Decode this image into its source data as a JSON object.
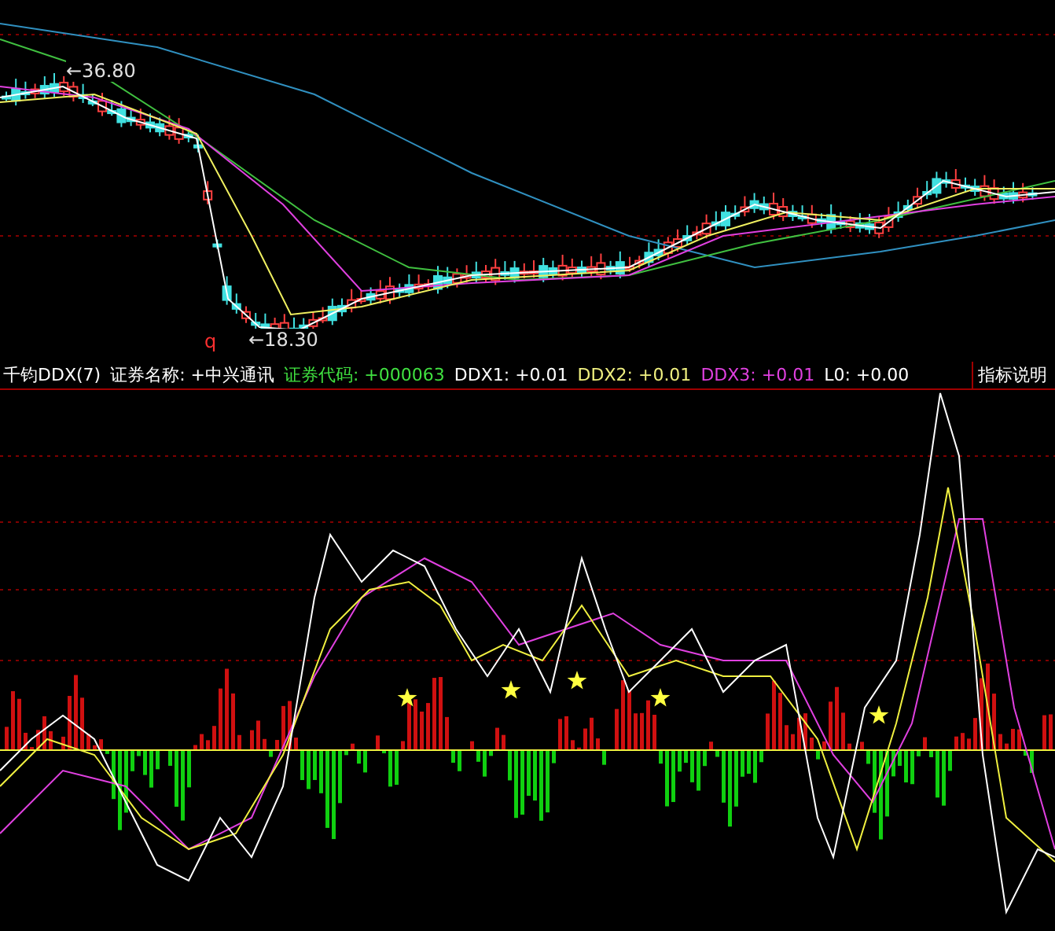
{
  "price_chart": {
    "high_label": "←36.80",
    "low_label": "←18.30",
    "marker": "q"
  },
  "indicator": {
    "legend": [
      {
        "text": "千钧DDX(7)",
        "color": "#ffffff"
      },
      {
        "text": "证券名称: +中兴通讯",
        "color": "#ffffff"
      },
      {
        "text": "证券代码: +000063",
        "color": "#40e040"
      },
      {
        "text": "DDX1: +0.01",
        "color": "#ffffff"
      },
      {
        "text": "DDX2: +0.01",
        "color": "#f0f080"
      },
      {
        "text": "DDX3: +0.01",
        "color": "#e040e0"
      },
      {
        "text": "L0: +0.00",
        "color": "#ffffff"
      }
    ],
    "help_button": "指标说明"
  }
}
